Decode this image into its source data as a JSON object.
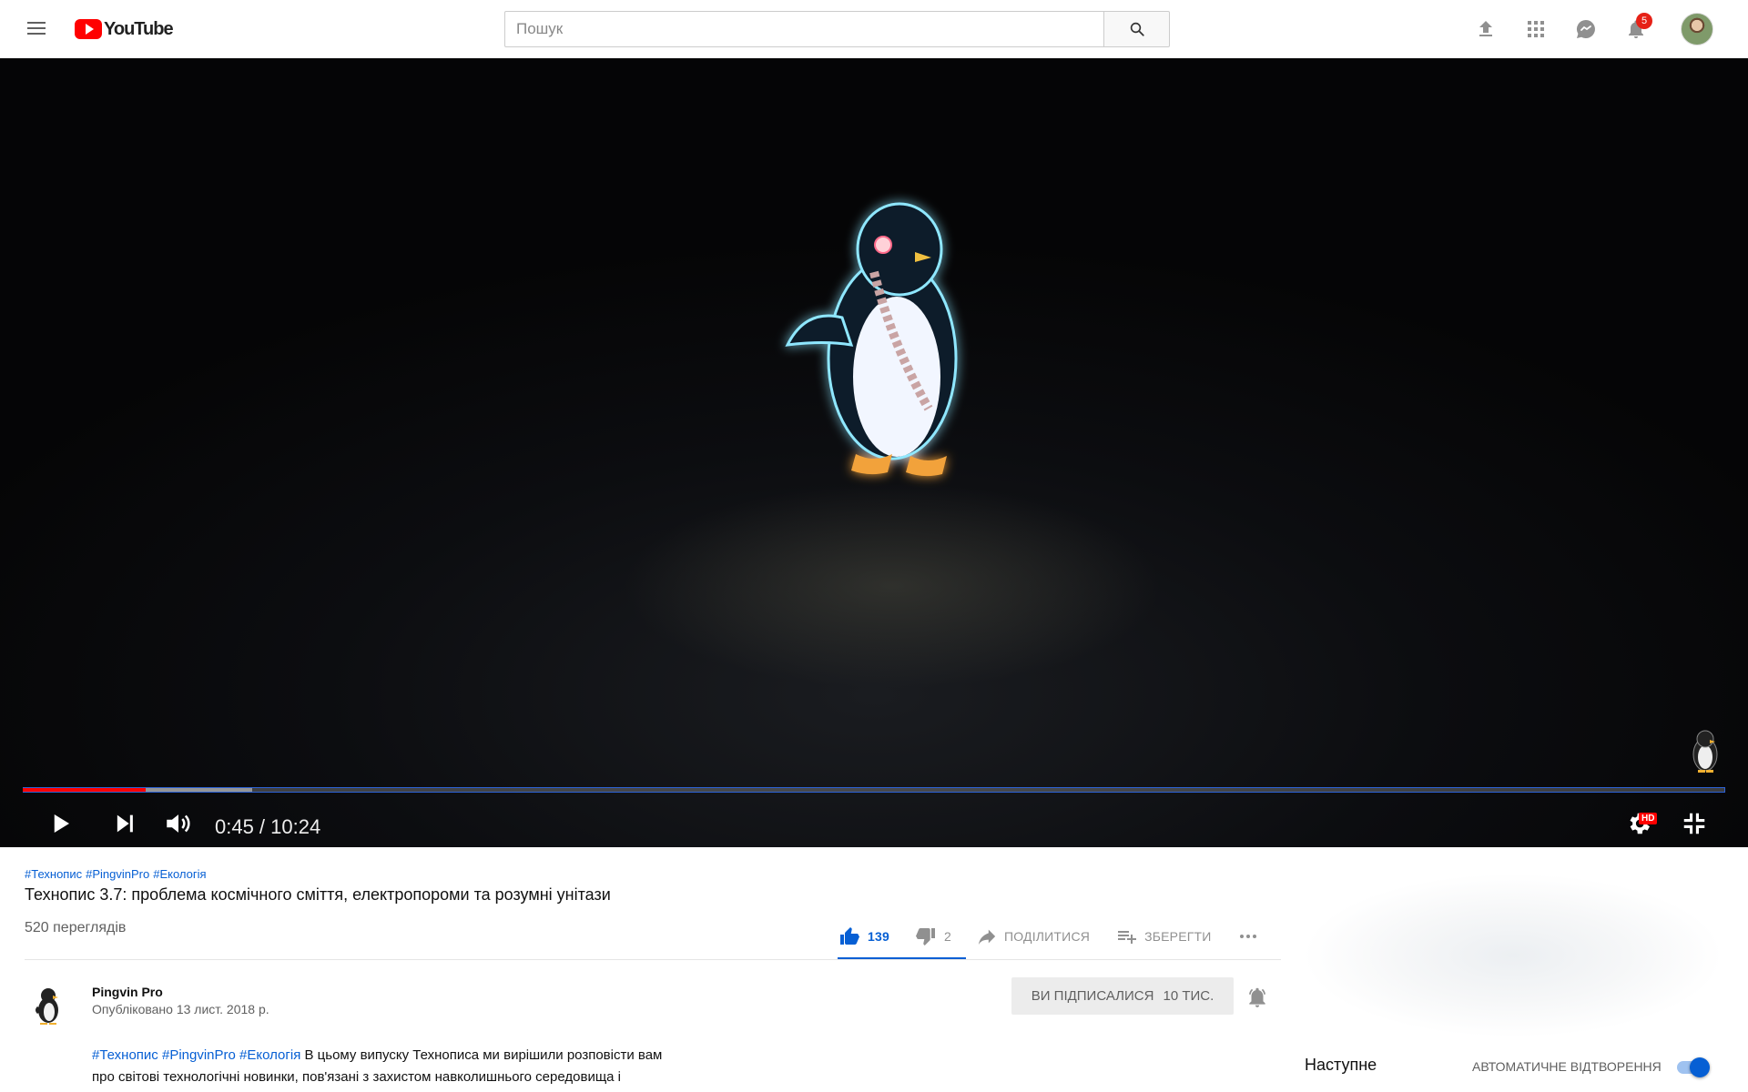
{
  "app": {
    "logo_text": "YouTube"
  },
  "search": {
    "placeholder": "Пошук",
    "value": ""
  },
  "header": {
    "notifications_count": "5"
  },
  "player": {
    "current_time": "0:45",
    "duration": "10:24",
    "timecode": "0:45 / 10:24",
    "progress_played": 0.072,
    "progress_buffered": 0.135,
    "quality_badge": "HD",
    "accent_color": "#ff0000"
  },
  "video": {
    "hashtags": [
      "#Технопис",
      "#PingvinPro",
      "#Екологія"
    ],
    "title": "Технопис 3.7: проблема космічного сміття, електропороми та розумні унітази",
    "views": "520 переглядів",
    "likes": "139",
    "dislikes": "2",
    "share_label": "Поділитися",
    "save_label": "Зберегти"
  },
  "channel": {
    "name": "Pingvin Pro",
    "published": "Опубліковано 13 лист. 2018 р.",
    "subscribed_label": "Ви підписалися",
    "subscriber_count": "10 тис."
  },
  "description": {
    "tags": [
      "#Технопис",
      "#PingvinPro",
      "#Екологія"
    ],
    "line1_text": " В цьому випуску Технописа ми вирішили розповісти вам",
    "line2_text": "про світові технологічні новинки, пов'язані з захистом навколишнього середовища і"
  },
  "sidebar": {
    "next_label": "Наступне",
    "autoplay_label": "Автоматичне відтворення",
    "autoplay_on": true
  }
}
